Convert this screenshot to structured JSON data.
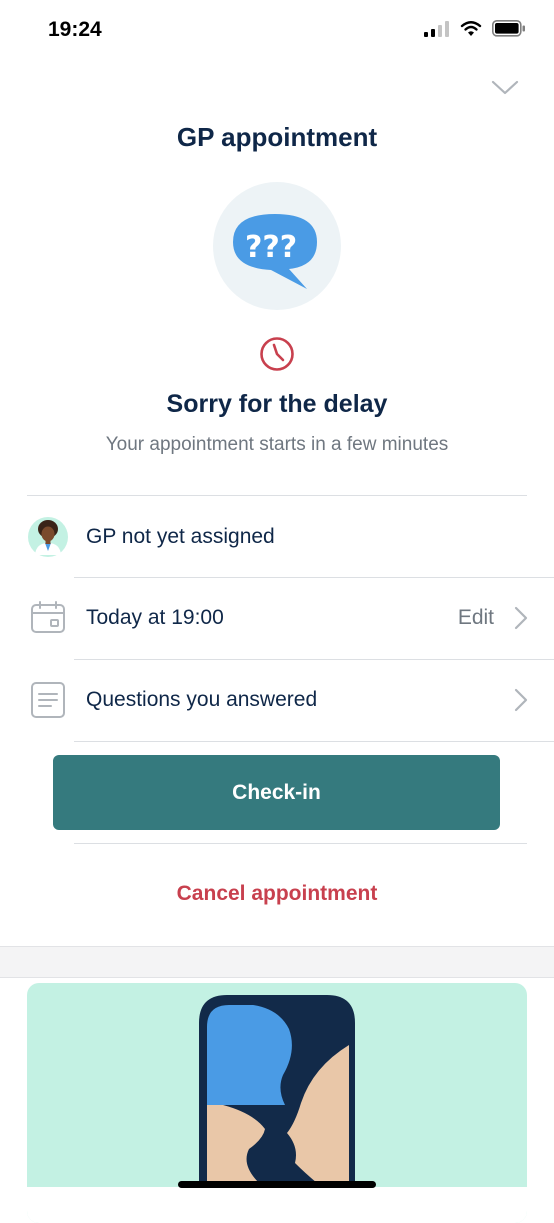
{
  "status_bar": {
    "time": "19:24"
  },
  "header": {
    "title": "GP appointment"
  },
  "delay": {
    "title": "Sorry for the delay",
    "subtitle": "Your appointment starts in a few minutes"
  },
  "details": {
    "gp": {
      "label": "GP not yet assigned"
    },
    "time": {
      "label": "Today at 19:00",
      "edit_label": "Edit"
    },
    "questions": {
      "label": "Questions you answered"
    }
  },
  "actions": {
    "checkin_label": "Check-in",
    "cancel_label": "Cancel appointment"
  },
  "colors": {
    "primary_text": "#0f2748",
    "button": "#357a7e",
    "cancel": "#c8404e",
    "accent_blue": "#4a9be5",
    "promo_bg": "#c3f1e3"
  }
}
